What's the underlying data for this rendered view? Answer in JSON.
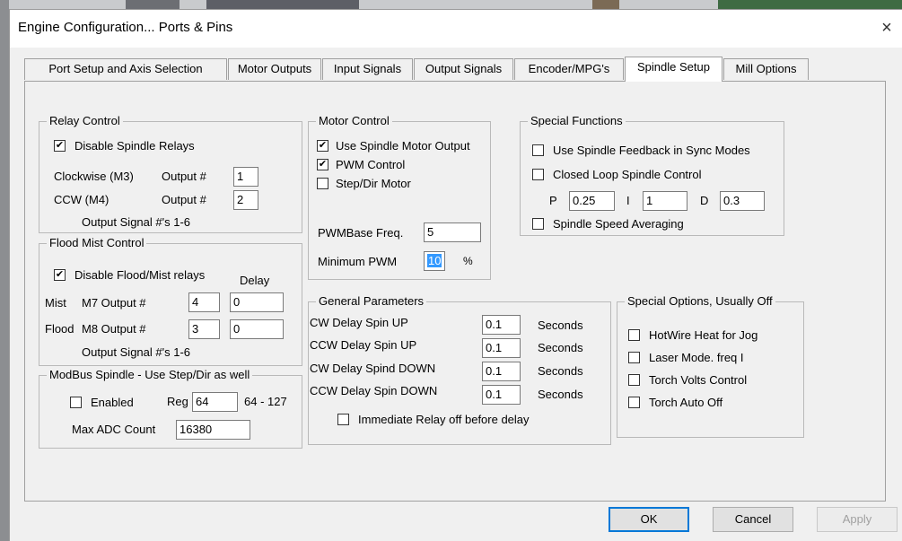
{
  "window": {
    "title": "Engine Configuration... Ports & Pins",
    "close_glyph": "×"
  },
  "tabs": [
    {
      "label": "Port Setup and Axis Selection"
    },
    {
      "label": "Motor Outputs"
    },
    {
      "label": "Input Signals"
    },
    {
      "label": "Output Signals"
    },
    {
      "label": "Encoder/MPG's"
    },
    {
      "label": "Spindle Setup",
      "active": true
    },
    {
      "label": "Mill Options"
    }
  ],
  "relay_control": {
    "legend": "Relay Control",
    "disable_relays": {
      "label": "Disable Spindle Relays",
      "checked": true
    },
    "cw": {
      "label": "Clockwise (M3)",
      "output_label": "Output #",
      "value": "1"
    },
    "ccw": {
      "label": "CCW (M4)",
      "output_label": "Output #",
      "value": "2"
    },
    "note": "Output Signal #'s 1-6"
  },
  "flood_mist": {
    "legend": "Flood Mist Control",
    "disable": {
      "label": "Disable Flood/Mist relays",
      "checked": true
    },
    "delay_label": "Delay",
    "mist": {
      "label": "Mist",
      "m_label": "M7 Output #",
      "output": "4",
      "delay": "0"
    },
    "flood": {
      "label": "Flood",
      "m_label": "M8 Output #",
      "output": "3",
      "delay": "0"
    },
    "note": "Output Signal #'s 1-6"
  },
  "modbus": {
    "legend": "ModBus Spindle - Use Step/Dir as well",
    "enabled": {
      "label": "Enabled",
      "checked": false
    },
    "reg_label": "Reg",
    "reg_value": "64",
    "range": "64 - 127",
    "max_adc_label": "Max ADC Count",
    "max_adc_value": "16380"
  },
  "motor_control": {
    "legend": "Motor Control",
    "use_spindle_motor": {
      "label": "Use Spindle Motor Output",
      "checked": true
    },
    "pwm_control": {
      "label": "PWM Control",
      "checked": true
    },
    "step_dir": {
      "label": "Step/Dir Motor",
      "checked": false
    },
    "pwm_base_label": "PWMBase Freq.",
    "pwm_base_value": "5",
    "min_pwm_label": "Minimum PWM",
    "min_pwm_value": "10",
    "min_pwm_unit": "%"
  },
  "special_functions": {
    "legend": "Special Functions",
    "feedback_sync": {
      "label": "Use Spindle Feedback in Sync Modes",
      "checked": false
    },
    "closed_loop": {
      "label": "Closed Loop Spindle Control",
      "checked": false
    },
    "p_label": "P",
    "p_value": "0.25",
    "i_label": "I",
    "i_value": "1",
    "d_label": "D",
    "d_value": "0.3",
    "speed_avg": {
      "label": "Spindle Speed Averaging",
      "checked": false
    }
  },
  "general": {
    "legend": "General Parameters",
    "unit": "Seconds",
    "rows": [
      {
        "label": "CW Delay Spin UP",
        "value": "0.1"
      },
      {
        "label": "CCW Delay Spin UP",
        "value": "0.1"
      },
      {
        "label": "CW Delay Spind DOWN",
        "value": "0.1"
      },
      {
        "label": "CCW Delay Spin DOWN",
        "value": "0.1"
      }
    ],
    "immediate_relay": {
      "label": "Immediate Relay off before delay",
      "checked": false
    }
  },
  "special_options": {
    "legend": "Special Options, Usually Off",
    "items": [
      {
        "label": "HotWire Heat for Jog",
        "checked": false
      },
      {
        "label": "Laser Mode. freq I",
        "checked": false
      },
      {
        "label": "Torch Volts Control",
        "checked": false
      },
      {
        "label": "Torch Auto Off",
        "checked": false
      }
    ]
  },
  "buttons": {
    "ok": "OK",
    "cancel": "Cancel",
    "apply": "Apply"
  },
  "check_glyph": "✔",
  "colors": {
    "selection": "#3399ff",
    "focus_border": "#0078d7",
    "panel_bg": "#f0f0f0"
  }
}
